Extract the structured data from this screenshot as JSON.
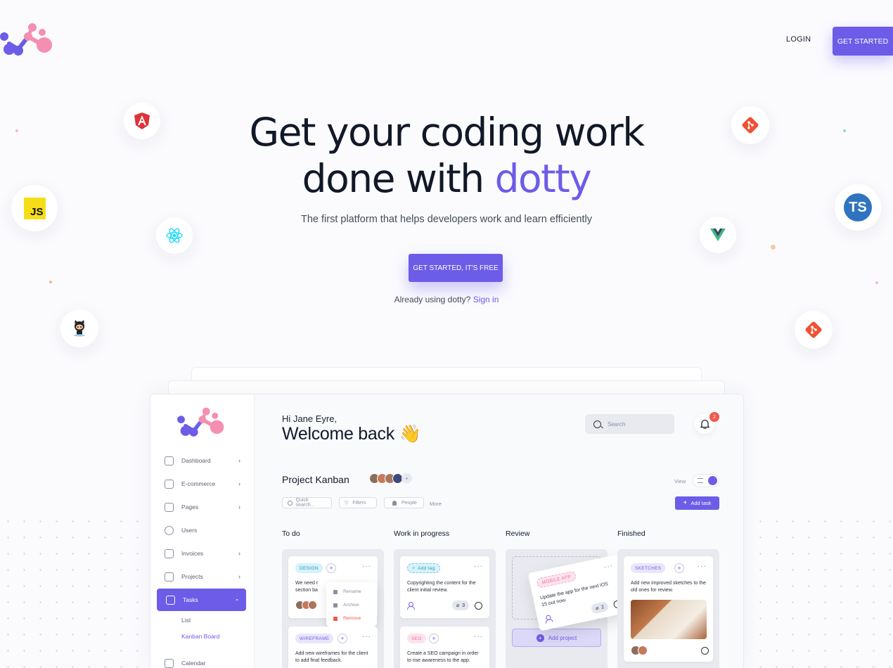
{
  "nav": {
    "login": "LOGIN",
    "get_started": "GET STARTED"
  },
  "hero": {
    "title_line1": "Get your coding work",
    "title_line2_prefix": "done with",
    "title_accent": "dotty",
    "subtitle": "The first platform that helps developers work and learn efficiently",
    "cta": "GET STARTED, IT'S FREE",
    "signin_prefix": "Already using dotty?",
    "signin_link": "Sign in"
  },
  "tech_badges": {
    "js_label": "JS",
    "ts_label": "TS"
  },
  "colors": {
    "accent": "#6c5ce7",
    "dark": "#121a2b",
    "danger": "#f4574a"
  },
  "dashboard": {
    "sidebar": {
      "items": [
        {
          "label": "Dashboard",
          "icon": "chart-icon"
        },
        {
          "label": "E-commerce",
          "icon": "bag-icon"
        },
        {
          "label": "Pages",
          "icon": "pages-icon"
        },
        {
          "label": "Users",
          "icon": "users-icon"
        },
        {
          "label": "Invoices",
          "icon": "invoice-icon"
        },
        {
          "label": "Projects",
          "icon": "projects-icon"
        },
        {
          "label": "Tasks",
          "icon": "tasks-icon"
        },
        {
          "label": "Calendar",
          "icon": "calendar-icon"
        }
      ],
      "sub_items": [
        "List",
        "Kanban Board"
      ]
    },
    "greeting": "Hi Jane Eyre,",
    "welcome": "Welcome back 👋",
    "search_placeholder": "Search",
    "notification_count": "2",
    "project_title": "Project Kanban",
    "view_label": "View",
    "filters": [
      "Quick search...",
      "Filters",
      "People"
    ],
    "more_label": "More",
    "add_task": "Add task",
    "columns": [
      {
        "title": "To do",
        "cards": [
          {
            "tag": "DESIGN",
            "text": "We need to redesign the section based on...",
            "text_visible": "We need t section ba"
          },
          {
            "tag": "WIREFRAME",
            "text": "Add new wireframes for the client to add final feedback."
          }
        ],
        "menu": [
          "Rename",
          "Archive",
          "Remove"
        ]
      },
      {
        "title": "Work in progress",
        "cards": [
          {
            "tag": "Add tag",
            "text": "Copyrighting the content for the client initial review.",
            "attachments": "3"
          },
          {
            "tag": "SEO",
            "text": "Create a SEO campaign in order to rise awareness to the app."
          }
        ]
      },
      {
        "title": "Review",
        "cards": [
          {
            "tag": "MOBILE APP",
            "text": "Update the app for the next iOS 15 out now.",
            "attachments": "2"
          }
        ],
        "add_project": "Add project"
      },
      {
        "title": "Finished",
        "cards": [
          {
            "tag": "SKETCHES",
            "text": "Add new improved sketches to the old ones for review."
          }
        ]
      }
    ]
  }
}
